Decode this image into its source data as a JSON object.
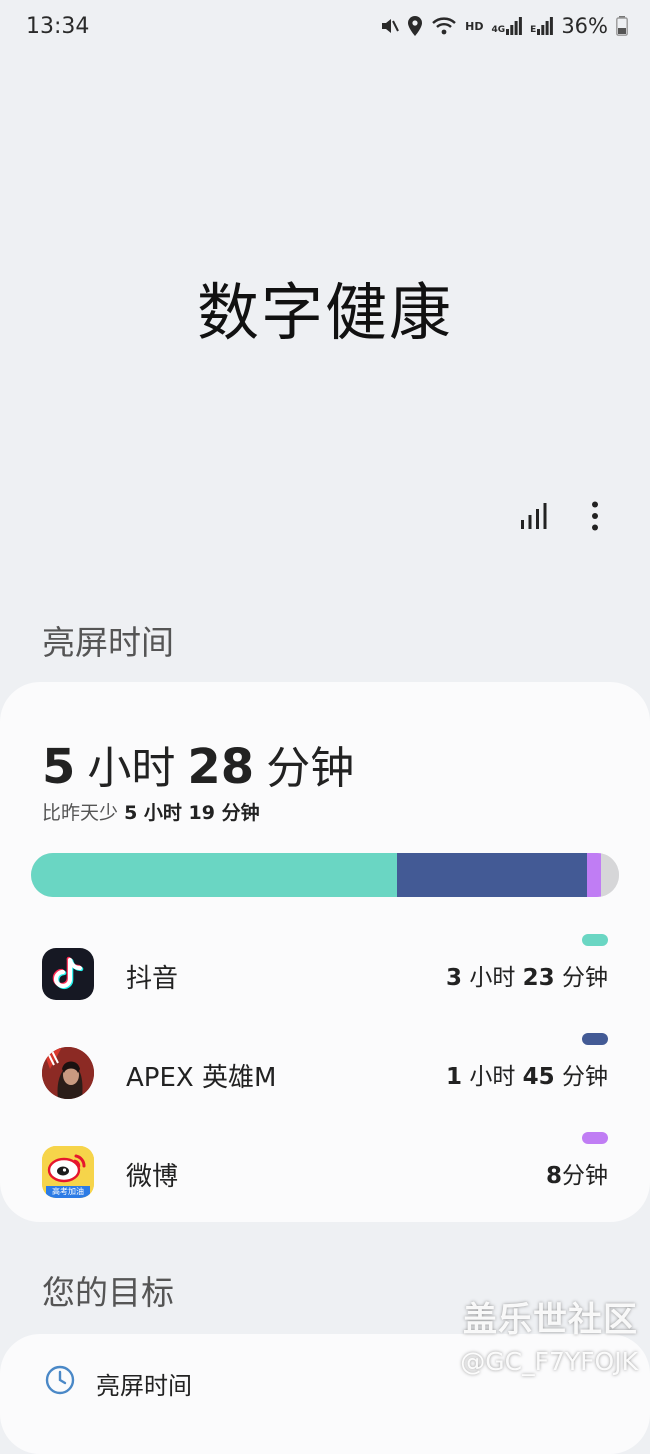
{
  "status_bar": {
    "time": "13:34",
    "hd_label": "HD",
    "net_4g": "4G",
    "net_e": "E",
    "battery": "36%"
  },
  "header": {
    "title": "数字健康",
    "stats_icon": "bar-chart-icon",
    "more_icon": "more-vertical-icon"
  },
  "screen_time": {
    "section_title": "亮屏时间",
    "total": {
      "hours": "5",
      "hours_unit": "小时",
      "minutes": "28",
      "minutes_unit": "分钟"
    },
    "compare_prefix": "比昨天少",
    "compare_value": "5 小时 19 分钟",
    "bar": [
      {
        "name": "抖音",
        "fraction": 0.623,
        "color": "#6ad6c3"
      },
      {
        "name": "APEX 英雄M",
        "fraction": 0.322,
        "color": "#435a95"
      },
      {
        "name": "微博",
        "fraction": 0.025,
        "color": "#c07df4"
      },
      {
        "name": "other",
        "fraction": 0.03,
        "color": "#d6d6d8"
      }
    ],
    "apps": [
      {
        "name": "抖音",
        "time_parts": [
          "3",
          " 小时 ",
          "23",
          " 分钟"
        ],
        "color": "#6ad6c3",
        "icon": "douyin-app-icon"
      },
      {
        "name": "APEX 英雄M",
        "time_parts": [
          "1",
          " 小时 ",
          "45",
          " 分钟"
        ],
        "color": "#435a95",
        "icon": "apex-app-icon"
      },
      {
        "name": "微博",
        "time_parts": [
          "8",
          "分钟",
          "",
          ""
        ],
        "color": "#c07df4",
        "icon": "weibo-app-icon",
        "icon_caption": "高考加油"
      }
    ]
  },
  "goals": {
    "section_title": "您的目标",
    "items": [
      {
        "label": "亮屏时间",
        "icon": "clock-icon"
      }
    ]
  },
  "watermark": {
    "line1": "盖乐世社区",
    "line2": "@GC_F7YFOJK"
  }
}
